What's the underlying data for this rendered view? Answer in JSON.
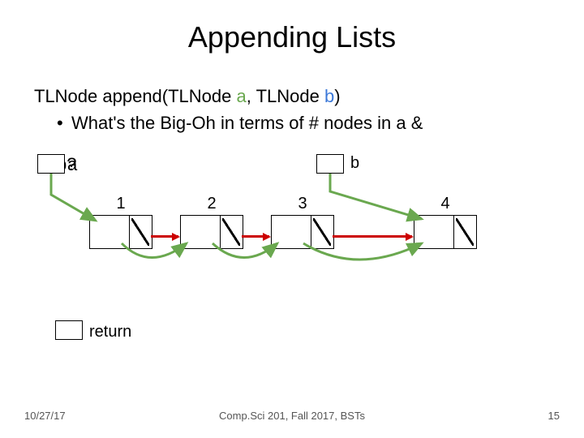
{
  "title": "Appending Lists",
  "signature": {
    "prefix": "TLNode append(TLNode ",
    "a": "a",
    "mid": ", TLNode ",
    "b": "b",
    "suffix": ")"
  },
  "bullet": {
    "dot": "•",
    "text": "What's the Big-Oh in terms of # nodes in a & "
  },
  "overlap": {
    "b": "b?",
    "a": "a"
  },
  "label_b": "b",
  "label_return": "return",
  "nodes": {
    "n1": "1",
    "n2": "2",
    "n3": "3",
    "n4": "4"
  },
  "footer": {
    "date": "10/27/17",
    "center": "Comp.Sci 201, Fall 2017, BSTs",
    "page": "15"
  },
  "chart_data": {
    "type": "diagram",
    "title": "Appending Lists",
    "description": "Linked list append visualization: list a = [1,2,3], list b = [4]; result links 3 -> 4.",
    "lists": {
      "a": [
        1,
        2,
        3
      ],
      "b": [
        4
      ]
    },
    "pointers": [
      {
        "name": "a",
        "points_to": 1,
        "color": "green"
      },
      {
        "name": "b",
        "points_to": 4,
        "color": "green"
      },
      {
        "name": "return",
        "points_to": null
      }
    ],
    "links": [
      {
        "from": 1,
        "to": 2,
        "color": "red"
      },
      {
        "from": 2,
        "to": 3,
        "color": "red"
      },
      {
        "from": 3,
        "to": 4,
        "color": "red"
      }
    ],
    "traversal_arrows_green_under": [
      [
        1,
        2
      ],
      [
        2,
        3
      ],
      [
        3,
        4
      ]
    ]
  }
}
